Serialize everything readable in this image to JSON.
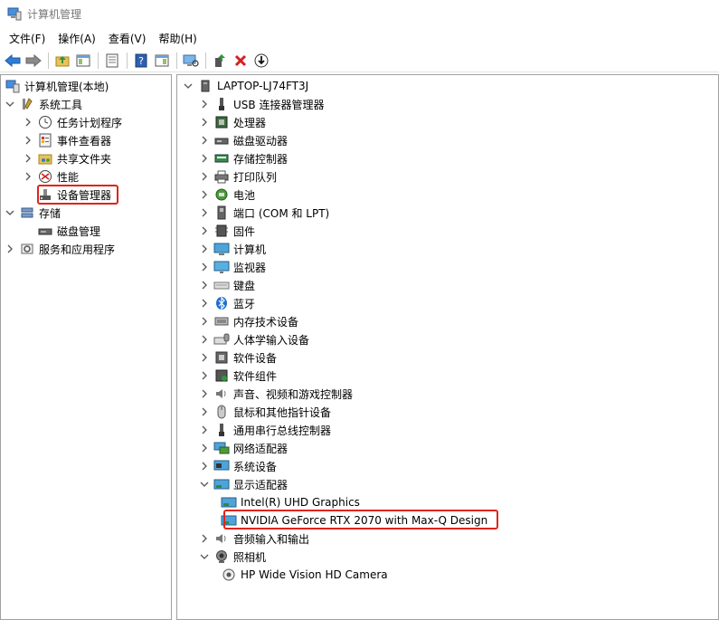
{
  "window": {
    "title": "计算机管理"
  },
  "menu": [
    "文件(F)",
    "操作(A)",
    "查看(V)",
    "帮助(H)"
  ],
  "left_tree": {
    "root": "计算机管理(本地)",
    "system_tools": "系统工具",
    "task_scheduler": "任务计划程序",
    "event_viewer": "事件查看器",
    "shared_folders": "共享文件夹",
    "performance": "性能",
    "device_manager": "设备管理器",
    "storage": "存储",
    "disk_management": "磁盘管理",
    "services_apps": "服务和应用程序"
  },
  "device_tree": {
    "computer_name": "LAPTOP-LJ74FT3J",
    "categories": [
      {
        "label": "USB 连接器管理器",
        "icon": "usb-icon"
      },
      {
        "label": "处理器",
        "icon": "processor-icon"
      },
      {
        "label": "磁盘驱动器",
        "icon": "disk-drive-icon"
      },
      {
        "label": "存储控制器",
        "icon": "storage-controller-icon"
      },
      {
        "label": "打印队列",
        "icon": "printer-icon"
      },
      {
        "label": "电池",
        "icon": "battery-icon"
      },
      {
        "label": "端口 (COM 和 LPT)",
        "icon": "port-icon"
      },
      {
        "label": "固件",
        "icon": "firmware-icon"
      },
      {
        "label": "计算机",
        "icon": "computer-icon"
      },
      {
        "label": "监视器",
        "icon": "monitor-icon"
      },
      {
        "label": "键盘",
        "icon": "keyboard-icon"
      },
      {
        "label": "蓝牙",
        "icon": "bluetooth-icon"
      },
      {
        "label": "内存技术设备",
        "icon": "memory-icon"
      },
      {
        "label": "人体学输入设备",
        "icon": "hid-icon"
      },
      {
        "label": "软件设备",
        "icon": "software-device-icon"
      },
      {
        "label": "软件组件",
        "icon": "software-component-icon"
      },
      {
        "label": "声音、视频和游戏控制器",
        "icon": "sound-icon"
      },
      {
        "label": "鼠标和其他指针设备",
        "icon": "mouse-icon"
      },
      {
        "label": "通用串行总线控制器",
        "icon": "usb-controller-icon"
      },
      {
        "label": "网络适配器",
        "icon": "network-icon"
      },
      {
        "label": "系统设备",
        "icon": "system-device-icon"
      },
      {
        "label": "显示适配器",
        "icon": "display-adapter-icon"
      }
    ],
    "display_adapters": [
      "Intel(R) UHD Graphics",
      "NVIDIA GeForce RTX 2070 with Max-Q Design"
    ],
    "audio": "音频输入和输出",
    "camera": "照相机",
    "camera_device": "HP Wide Vision HD Camera"
  },
  "colors": {
    "highlight": "#e0241b",
    "accent_blue": "#1f6fd1"
  }
}
